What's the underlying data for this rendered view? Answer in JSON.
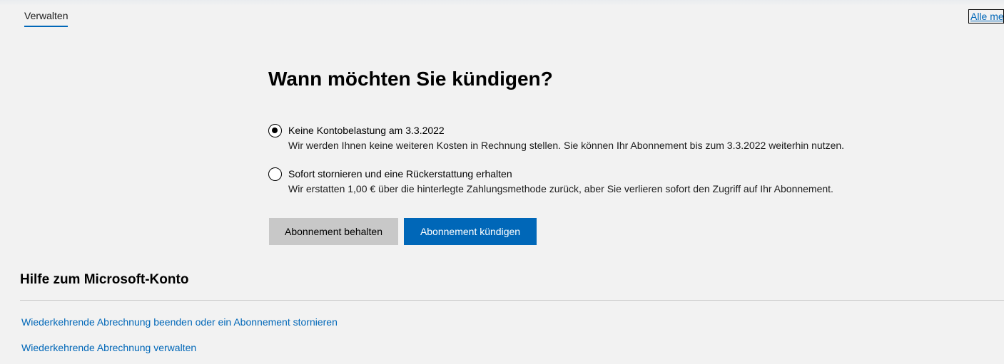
{
  "nav": {
    "active_tab": "Verwalten",
    "all_link": "Alle me"
  },
  "main": {
    "heading": "Wann möchten Sie kündigen?",
    "options": [
      {
        "title": "Keine Kontobelastung am 3.3.2022",
        "description": "Wir werden Ihnen keine weiteren Kosten in Rechnung stellen. Sie können Ihr Abonnement bis zum 3.3.2022 weiterhin nutzen.",
        "selected": true
      },
      {
        "title": "Sofort stornieren und eine Rückerstattung erhalten",
        "description": "Wir erstatten 1,00 € über die hinterlegte Zahlungsmethode zurück, aber Sie verlieren sofort den Zugriff auf Ihr Abonnement.",
        "selected": false
      }
    ],
    "keep_button": "Abonnement behalten",
    "cancel_button": "Abonnement kündigen"
  },
  "help": {
    "title": "Hilfe zum Microsoft-Konto",
    "links": [
      "Wiederkehrende Abrechnung beenden oder ein Abonnement stornieren",
      "Wiederkehrende Abrechnung verwalten"
    ]
  },
  "colors": {
    "accent": "#0067b8",
    "background": "#f2f2f2",
    "secondary_button": "#c8c8c8"
  }
}
